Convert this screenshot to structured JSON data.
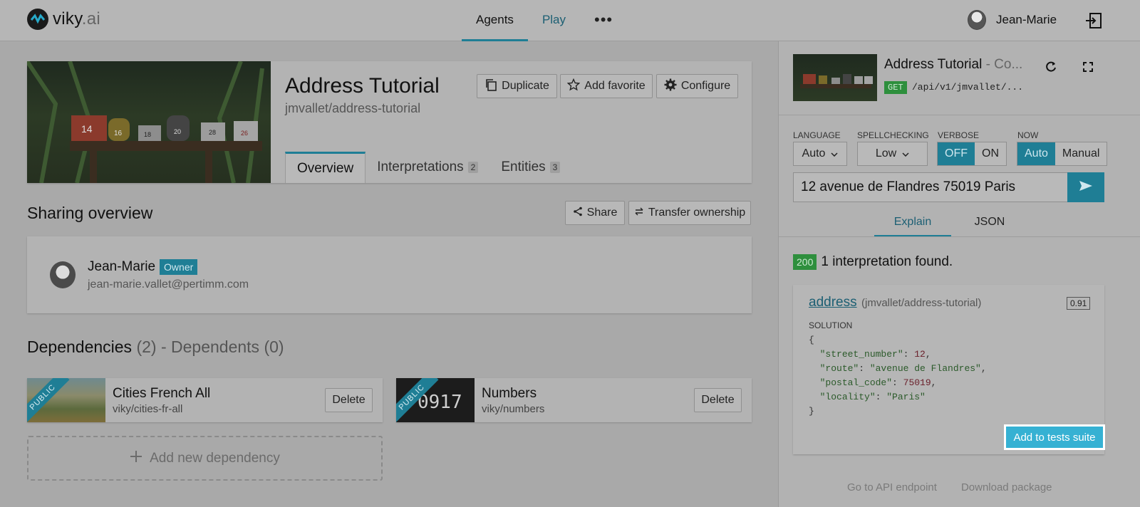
{
  "app": {
    "logo_main": "viky",
    "logo_suffix": ".ai"
  },
  "nav": {
    "tabs": [
      "Agents",
      "Play"
    ],
    "more": "•••"
  },
  "user": {
    "name": "Jean-Marie"
  },
  "agent": {
    "title": "Address Tutorial",
    "slug": "jmvallet/address-tutorial",
    "actions": {
      "duplicate": "Duplicate",
      "favorite": "Add favorite",
      "configure": "Configure"
    },
    "tabs": [
      {
        "label": "Overview",
        "count": ""
      },
      {
        "label": "Interpretations",
        "count": "2"
      },
      {
        "label": "Entities",
        "count": "3"
      }
    ],
    "mailbox_numbers": [
      "14",
      "16",
      "18",
      "20",
      "28",
      "26"
    ]
  },
  "sharing": {
    "title": "Sharing overview",
    "share": "Share",
    "transfer": "Transfer ownership",
    "owner": {
      "name": "Jean-Marie",
      "badge": "Owner",
      "email": "jean-marie.vallet@pertimm.com"
    }
  },
  "dependencies": {
    "title": "Dependencies",
    "count": "(2)",
    "dependents_label": "- Dependents",
    "dependents_count": "(0)",
    "items": [
      {
        "title": "Cities French All",
        "slug": "viky/cities-fr-all",
        "ribbon": "PUBLIC",
        "delete": "Delete"
      },
      {
        "title": "Numbers",
        "slug": "viky/numbers",
        "ribbon": "PUBLIC",
        "delete": "Delete"
      }
    ],
    "add_new": "Add new dependency"
  },
  "playground": {
    "title": "Address Tutorial",
    "title_suffix": " - Co...",
    "method": "GET",
    "endpoint": "/api/v1/jmvallet/...",
    "language": {
      "label": "LANGUAGE",
      "value": "Auto"
    },
    "spellchecking": {
      "label": "SPELLCHECKING",
      "value": "Low"
    },
    "verbose": {
      "label": "VERBOSE",
      "options": [
        "OFF",
        "ON"
      ],
      "selected": "OFF"
    },
    "now": {
      "label": "NOW",
      "options": [
        "Auto",
        "Manual"
      ],
      "selected": "Auto"
    },
    "query": "12 avenue de Flandres 75019 Paris",
    "tabs": [
      "Explain",
      "JSON"
    ],
    "status_code": "200",
    "status_text": "1 interpretation found.",
    "interpretation": {
      "name": "address",
      "namespace": "(jmvallet/address-tutorial)",
      "score": "0.91",
      "solution_label": "SOLUTION",
      "solution": {
        "street_number": "12",
        "route": "\"avenue de Flandres\"",
        "postal_code": "75019",
        "locality": "\"Paris\""
      }
    },
    "add_to_tests": "Add to tests suite",
    "footer": [
      "Go to API endpoint",
      "Download package"
    ]
  },
  "colors": {
    "accent": "#1f7e95",
    "success": "#2e8f3d",
    "highlight": "#36b1d3"
  }
}
